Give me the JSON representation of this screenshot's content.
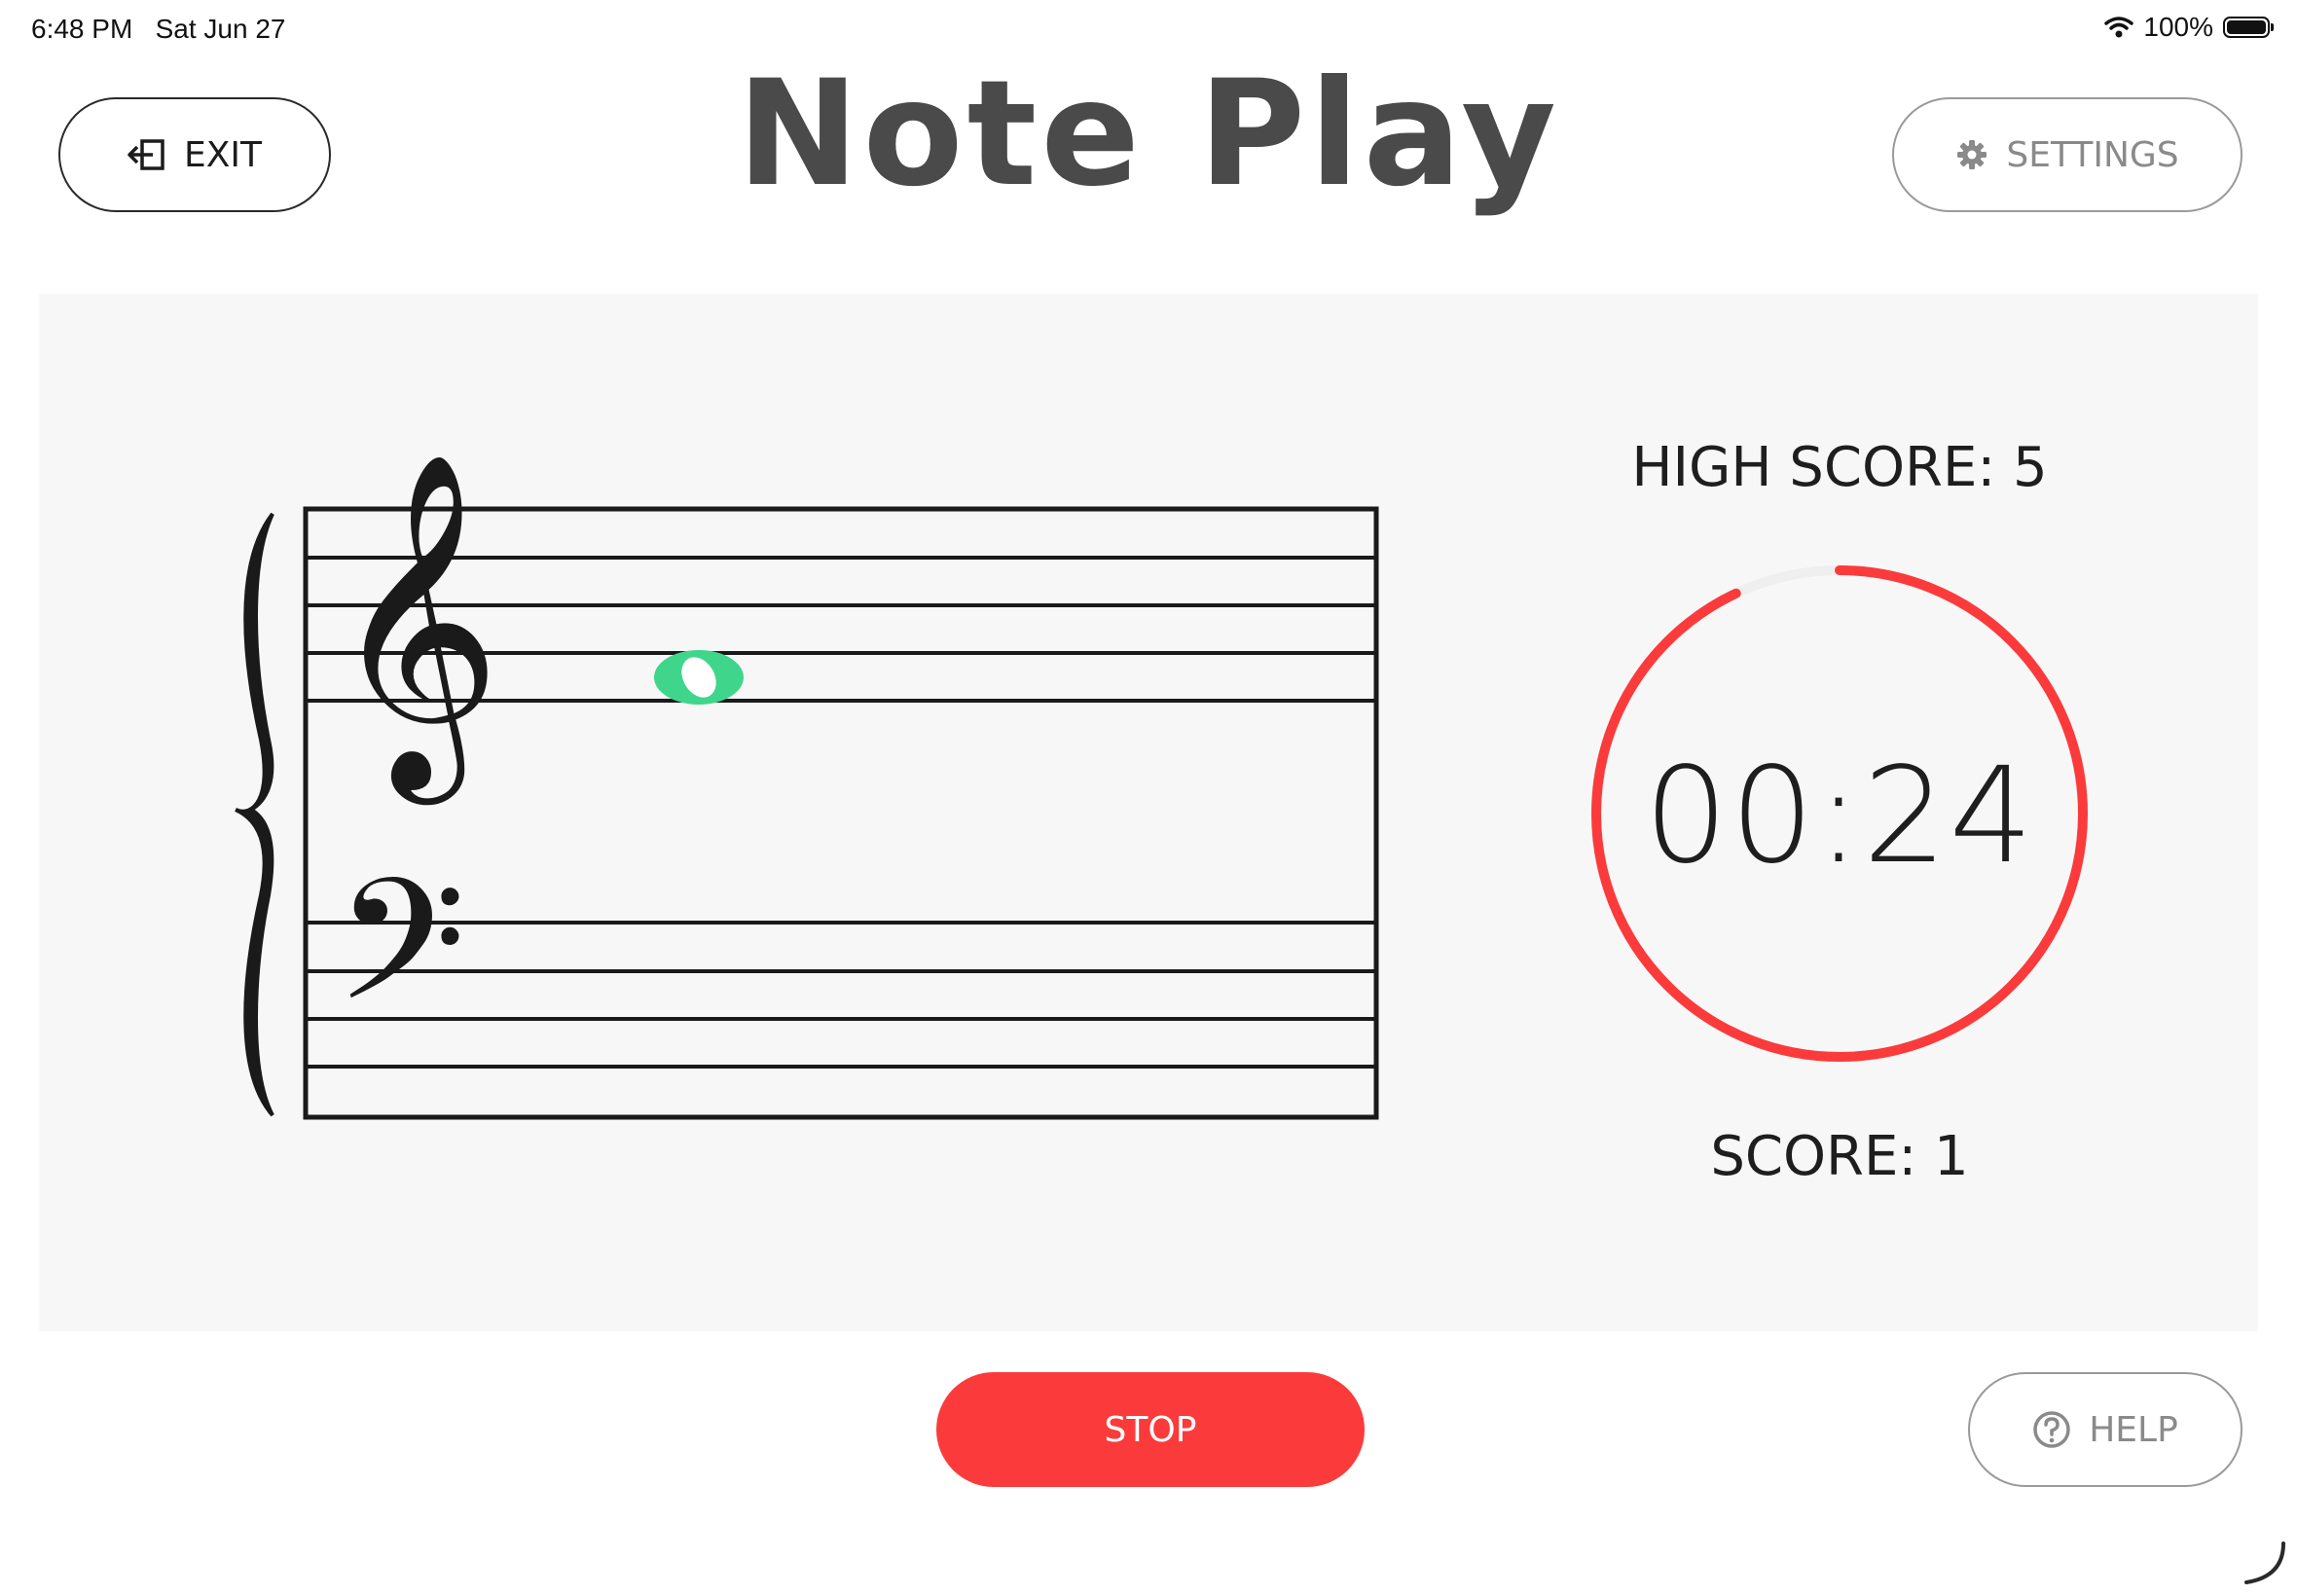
{
  "status_bar": {
    "time": "6:48 PM",
    "date": "Sat Jun 27",
    "battery": "100%",
    "battery_level": 1.0
  },
  "header": {
    "title": "Note Play",
    "exit_label": "EXIT",
    "settings_label": "SETTINGS"
  },
  "game": {
    "high_score_label": "HIGH SCORE: 5",
    "score_label": "SCORE: 1",
    "timer": "00:24",
    "timer_progress": 0.93,
    "note_color": "#3fd68b",
    "timer_color": "#fb3b3b",
    "timer_track_color": "#efefef"
  },
  "footer": {
    "stop_label": "STOP",
    "help_label": "HELP"
  },
  "icons": {
    "exit": "exit-icon",
    "settings": "gear-icon",
    "help": "help-circle-icon",
    "treble_clef": "treble-clef-icon",
    "bass_clef": "bass-clef-icon",
    "brace": "brace-icon"
  }
}
